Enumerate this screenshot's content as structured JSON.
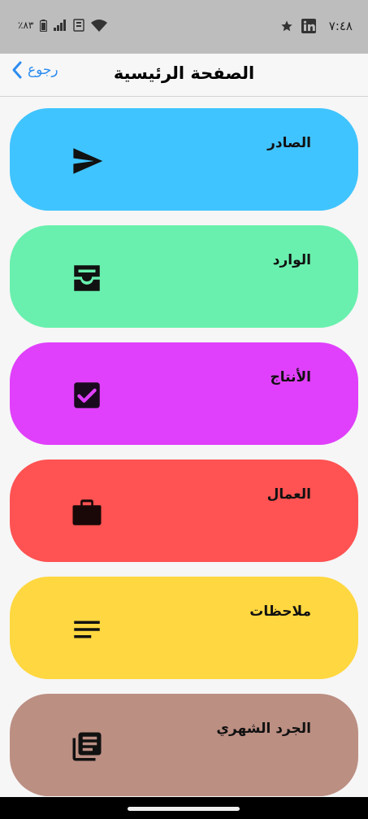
{
  "status_bar": {
    "time": "٧:٤٨",
    "battery": "٪٨٣",
    "icons_right": [
      "star-icon",
      "linkedin-icon"
    ],
    "icons_left": [
      "battery-icon",
      "signal-icon",
      "volte-icon",
      "wifi-icon"
    ]
  },
  "nav": {
    "back_label": "رجوع",
    "title": "الصفحة الرئيسية"
  },
  "cards": [
    {
      "label": "الصادر",
      "icon": "send-icon",
      "color": "#40c4ff"
    },
    {
      "label": "الوارد",
      "icon": "inbox-icon",
      "color": "#69f0ae"
    },
    {
      "label": "الأنتاج",
      "icon": "checkbox-icon",
      "color": "#e040fb"
    },
    {
      "label": "العمال",
      "icon": "briefcase-icon",
      "color": "#ff5252"
    },
    {
      "label": "ملاحظات",
      "icon": "notes-icon",
      "color": "#ffd740"
    },
    {
      "label": "الجرد الشهري",
      "icon": "library-books-icon",
      "color": "#bc8f83"
    }
  ]
}
